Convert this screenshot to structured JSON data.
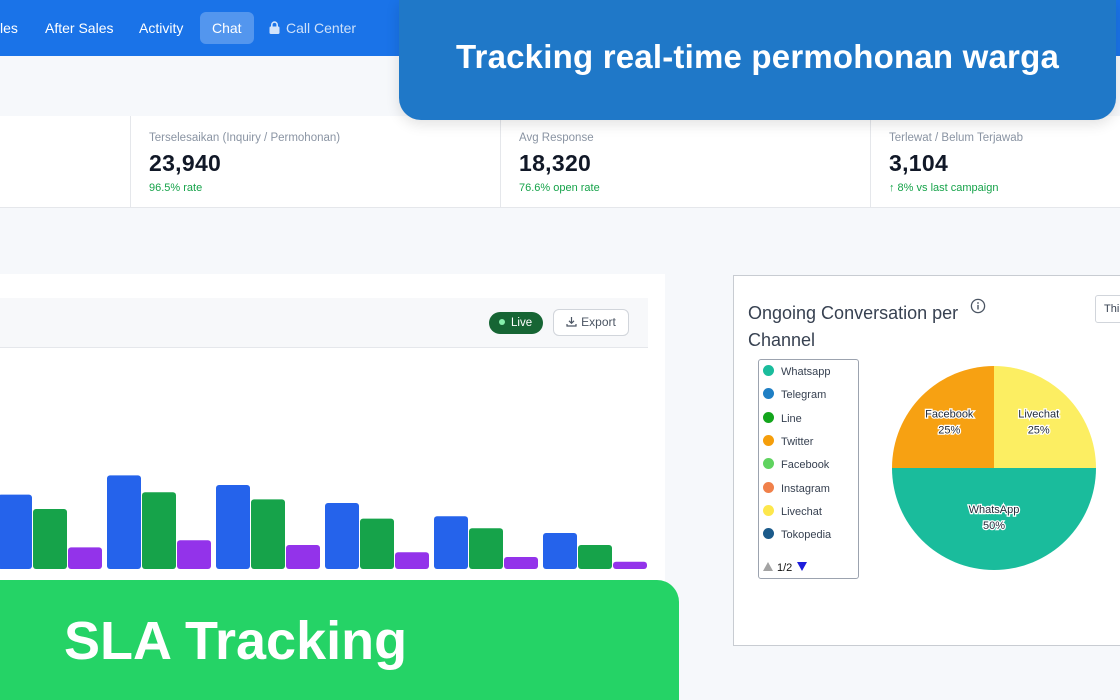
{
  "nav": {
    "items": [
      "les",
      "After Sales",
      "Activity",
      "Chat",
      "Call Center"
    ],
    "active": "Chat"
  },
  "stats": [
    {
      "label": "Terselesaikan (Inquiry / Permohonan)",
      "value": "23,940",
      "sub": "96.5% rate"
    },
    {
      "label": "Avg Response",
      "value": "18,320",
      "sub": "76.6% open rate"
    },
    {
      "label": "Terlewat / Belum Terjawab",
      "value": "3,104",
      "sub": "↑ 8% vs last campaign"
    }
  ],
  "activity_chart": {
    "live_label": "Live",
    "export_label": "Export",
    "chart_data": {
      "type": "bar",
      "series": [
        {
          "color": "#2563eb",
          "values": [
            62,
            78,
            70,
            55,
            44,
            30
          ]
        },
        {
          "color": "#16a34a",
          "values": [
            50,
            64,
            58,
            42,
            34,
            20
          ]
        },
        {
          "color": "#9333ea",
          "values": [
            18,
            24,
            20,
            14,
            10,
            6
          ]
        }
      ],
      "ylim": [
        0,
        100
      ]
    }
  },
  "pie_panel": {
    "title": "Ongoing Conversation per Channel",
    "period_label": "Thi",
    "legend": [
      {
        "label": "Whatsapp",
        "color": "#1abc9c"
      },
      {
        "label": "Telegram",
        "color": "#1f7fc4"
      },
      {
        "label": "Line",
        "color": "#13a51c"
      },
      {
        "label": "Twitter",
        "color": "#f59e0b"
      },
      {
        "label": "Facebook",
        "color": "#5fd35f"
      },
      {
        "label": "Instagram",
        "color": "#f0804a"
      },
      {
        "label": "Livechat",
        "color": "#fde74c"
      },
      {
        "label": "Tokopedia",
        "color": "#1b5a8a"
      }
    ],
    "pager": "1/2",
    "chart_data": {
      "type": "pie",
      "slices": [
        {
          "label": "WhatsApp",
          "value": 50,
          "pct": "50%",
          "color": "#1abc9c"
        },
        {
          "label": "Facebook",
          "value": 25,
          "pct": "25%",
          "color": "#f7a112"
        },
        {
          "label": "Livechat",
          "value": 25,
          "pct": "25%",
          "color": "#fcee62"
        }
      ]
    }
  },
  "banners": {
    "top": "Tracking real-time permohonan warga",
    "bottom": "SLA Tracking"
  }
}
